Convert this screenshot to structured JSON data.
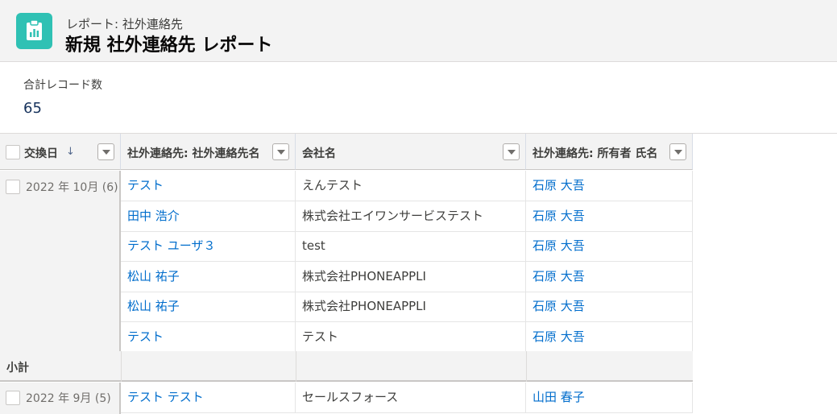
{
  "header": {
    "subtitle": "レポート: 社外連絡先",
    "title": "新規 社外連絡先 レポート",
    "icon": "report-icon",
    "icon_color": "#2fc1b4"
  },
  "summary": {
    "label": "合計レコード数",
    "value": "65"
  },
  "columns": [
    {
      "label": "交換日",
      "sort": "↓"
    },
    {
      "label": "社外連絡先: 社外連絡先名"
    },
    {
      "label": "会社名"
    },
    {
      "label": "社外連絡先: 所有者 氏名"
    }
  ],
  "groups": [
    {
      "label": "2022 年 10月 (6)",
      "rows": [
        {
          "name": "テスト",
          "company": "えんテスト",
          "owner": "石原 大吾"
        },
        {
          "name": "田中 浩介",
          "company": "株式会社エイワンサービステスト",
          "owner": "石原 大吾"
        },
        {
          "name": "テスト ユーザ３",
          "company": "test",
          "owner": "石原 大吾"
        },
        {
          "name": "松山 祐子",
          "company": "株式会社PHONEAPPLI",
          "owner": "石原 大吾"
        },
        {
          "name": "松山 祐子",
          "company": "株式会社PHONEAPPLI",
          "owner": "石原 大吾"
        },
        {
          "name": "テスト",
          "company": "テスト",
          "owner": "石原 大吾"
        }
      ],
      "subtotal_label": "小計"
    },
    {
      "label": "2022 年 9月 (5)",
      "rows": [
        {
          "name": "テスト テスト",
          "company": "セールスフォース",
          "owner": "山田 春子"
        }
      ]
    }
  ]
}
